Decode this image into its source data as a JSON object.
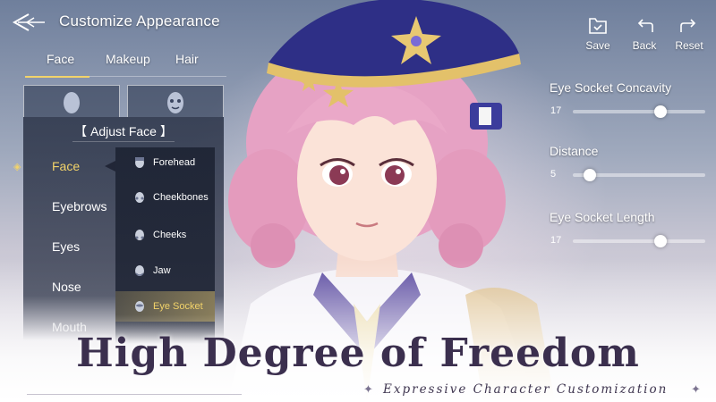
{
  "header": {
    "title": "Customize Appearance"
  },
  "tabs": [
    {
      "label": "Face",
      "active": true
    },
    {
      "label": "Makeup",
      "active": false
    },
    {
      "label": "Hair",
      "active": false
    }
  ],
  "adjust_panel": {
    "title": "【 Adjust Face 】",
    "bullet": "◈",
    "categories": [
      {
        "label": "Face",
        "active": true
      },
      {
        "label": "Eyebrows",
        "active": false
      },
      {
        "label": "Eyes",
        "active": false
      },
      {
        "label": "Nose",
        "active": false
      },
      {
        "label": "Mouth",
        "active": false
      }
    ],
    "sub_items": [
      {
        "label": "Forehead",
        "active": false
      },
      {
        "label": "Cheekbones",
        "active": false
      },
      {
        "label": "Cheeks",
        "active": false
      },
      {
        "label": "Jaw",
        "active": false
      },
      {
        "label": "Eye Socket",
        "active": true
      }
    ]
  },
  "actions": {
    "save": "Save",
    "back": "Back",
    "reset": "Reset"
  },
  "sliders": [
    {
      "label": "Eye Socket Concavity",
      "value": "17",
      "fraction": 0.66
    },
    {
      "label": "Distance",
      "value": "5",
      "fraction": 0.13
    },
    {
      "label": "Eye Socket Length",
      "value": "17",
      "fraction": 0.66
    }
  ],
  "headline": "High Degree of Freedom",
  "subline": "Expressive Character Customization",
  "colors": {
    "accent": "#f2d36a",
    "panel": "#262e42",
    "headline": "#3b2f4e"
  }
}
